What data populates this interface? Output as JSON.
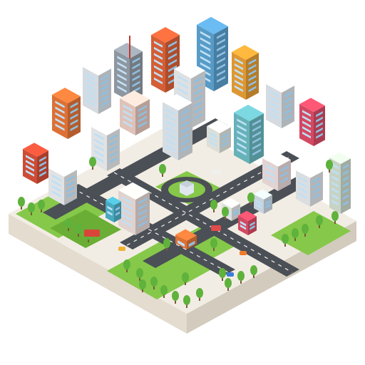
{
  "scene": {
    "subject": "isometric-city-block",
    "palette": {
      "background": "#ffffff",
      "base_top": "#f2ede4",
      "base_left": "#e3dccf",
      "base_right": "#d3cbbd",
      "grass": "#86c84a",
      "grass_dark": "#6aae35",
      "road": "#4b4f56",
      "road_line": "#f4f4f4",
      "tree": "#5fb23c",
      "tree_dark": "#3f8f2a"
    }
  }
}
